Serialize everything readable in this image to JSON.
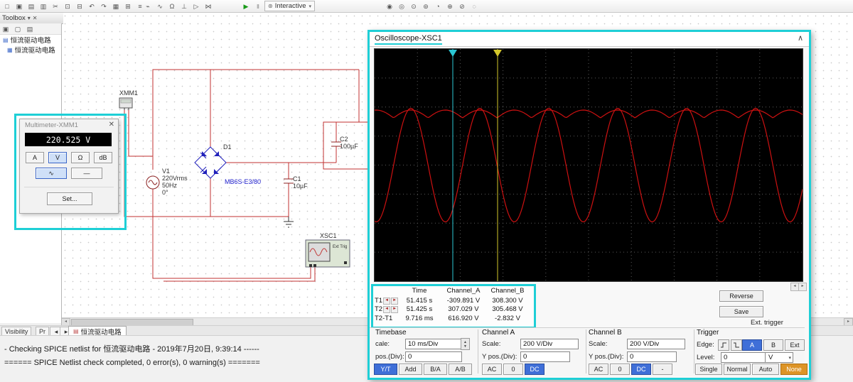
{
  "colors": {
    "highlight": "#1ecfd6",
    "wire": "#c03232",
    "trace": "#cc1111",
    "active_button": "#3f6fd8",
    "none_button": "#dd9426"
  },
  "top_toolbar": {
    "file_icons": [
      "□",
      "▣",
      "▤",
      "▥",
      "✂",
      "⊡",
      "⊟",
      "↶",
      "↷",
      "▦",
      "⊞",
      "≡"
    ],
    "component_icons": [
      "⌁",
      "∿",
      "Ω",
      "⊥",
      "▷",
      "⋈"
    ],
    "probe_icons": [
      "◉",
      "◎",
      "⊙",
      "⊚",
      "◔",
      "⊕",
      "⊘",
      "◌"
    ],
    "play_icon": "▶",
    "pause_icon": "Ⅱ",
    "stop_icon": "■",
    "gear_icon": "⊛",
    "caret_icon": "▾",
    "run_label": "Interactive"
  },
  "toolbox": {
    "title": "Toolbox",
    "pin_icon": "▾",
    "close_icon": "✕",
    "mini_icons": [
      "▣",
      "▢",
      "▤"
    ],
    "tree": [
      {
        "glyph": "▤",
        "label": "恒流驱动电路"
      },
      {
        "glyph": "▦",
        "label": "恒流驱动电路"
      }
    ]
  },
  "schematic": {
    "xmm1_label": "XMM1",
    "v1": {
      "ref": "V1",
      "value": "220Vrms",
      "freq": "50Hz",
      "phase": "0°"
    },
    "d1": {
      "ref": "D1",
      "part": "MB6S-E3/80"
    },
    "c1": {
      "ref": "C1",
      "value": "10µF"
    },
    "c2": {
      "ref": "C2",
      "value": "100µF"
    },
    "xsc1": {
      "ref": "XSC1",
      "ext_trig": "Ext Trig"
    }
  },
  "multimeter": {
    "title": "Multimeter-XMM1",
    "close_icon": "✕",
    "reading": "220.525 V",
    "mode_buttons": [
      {
        "label": "A"
      },
      {
        "label": "V",
        "active": true
      },
      {
        "label": "Ω"
      },
      {
        "label": "dB"
      }
    ],
    "wave_buttons": [
      {
        "label": "∿",
        "active": true
      },
      {
        "label": "—"
      }
    ],
    "set_label": "Set..."
  },
  "oscilloscope": {
    "title": "Oscilloscope-XSC1",
    "collapse_icon": "∧",
    "scroll_left_icon": "◂",
    "scroll_right_icon": "▸",
    "readout": {
      "headers": [
        "Time",
        "Channel_A",
        "Channel_B"
      ],
      "rows": [
        {
          "label": "T1",
          "arrowL": "◄",
          "arrowR": "►",
          "time": "51.415 s",
          "cha": "-309.891 V",
          "chb": "308.300 V"
        },
        {
          "label": "T2",
          "arrowL": "◄",
          "arrowR": "►",
          "time": "51.425 s",
          "cha": "307.029 V",
          "chb": "305.468 V"
        },
        {
          "label": "T2-T1",
          "arrowL": "",
          "arrowR": "",
          "time": "9.716 ms",
          "cha": "616.920 V",
          "chb": "-2.832 V"
        }
      ]
    },
    "reverse_label": "Reverse",
    "save_label": "Save",
    "ext_trigger_label": "Ext. trigger",
    "timebase": {
      "title": "Timebase",
      "scale_label": "cale:",
      "scale_value": "10 ms/Div",
      "pos_label": "pos.(Div):",
      "pos_value": "0",
      "buttons": [
        {
          "label": "Y/T",
          "active": true
        },
        {
          "label": "Add"
        },
        {
          "label": "B/A"
        },
        {
          "label": "A/B"
        }
      ]
    },
    "channel_a": {
      "title": "Channel A",
      "scale_label": "Scale:",
      "scale_value": "200  V/Div",
      "pos_label": "Y pos.(Div):",
      "pos_value": "0",
      "buttons": [
        {
          "label": "AC"
        },
        {
          "label": "0"
        },
        {
          "label": "DC",
          "active": true
        }
      ]
    },
    "channel_b": {
      "title": "Channel B",
      "scale_label": "Scale:",
      "scale_value": "200  V/Div",
      "pos_label": "Y pos.(Div):",
      "pos_value": "0",
      "buttons": [
        {
          "label": "AC"
        },
        {
          "label": "0"
        },
        {
          "label": "DC",
          "active": true
        },
        {
          "label": "-"
        }
      ]
    },
    "trigger": {
      "title": "Trigger",
      "edge_label": "Edge:",
      "edge_buttons": [
        {
          "label": "A",
          "active": true
        },
        {
          "label": "B"
        },
        {
          "label": "Ext"
        }
      ],
      "level_label": "Level:",
      "level_value": "0",
      "unit": "V",
      "mode_buttons": [
        {
          "label": "Single"
        },
        {
          "label": "Normal"
        },
        {
          "label": "Auto"
        },
        {
          "label": "None",
          "active": true,
          "orange": true
        }
      ]
    }
  },
  "chart_data": {
    "type": "line",
    "title": "Oscilloscope-XSC1 traces",
    "x_axis": {
      "label": "Time",
      "scale": "10 ms/Div",
      "divisions": 10
    },
    "y_axis": {
      "scale": "200 V/Div",
      "divisions": 8
    },
    "series": [
      {
        "name": "Channel_A",
        "shape": "sine",
        "amplitude_V": 310,
        "period_ms": 20,
        "color": "#cc1111"
      },
      {
        "name": "Channel_B",
        "shape": "filtered_dc_ripple",
        "mean_V": 306,
        "ripple_V": 20,
        "color": "#cc1111"
      }
    ],
    "cursors": [
      {
        "name": "T1",
        "time_s": 51.415,
        "channel_a_V": -309.891,
        "channel_b_V": 308.3,
        "color": "#2bc7d4"
      },
      {
        "name": "T2",
        "time_s": 51.425,
        "channel_a_V": 307.029,
        "channel_b_V": 305.468,
        "color": "#d4c72b"
      }
    ]
  },
  "tabs": {
    "visibility": "Visibility",
    "pr": "Pr",
    "left_arrow": "◂",
    "right_arrow": "▸",
    "sheet": "恒流驱动电路",
    "sheet_glyph": "▤"
  },
  "status": {
    "line1": "- Checking SPICE netlist for 恒流驱动电路 - 2019年7月20日, 9:39:14 ------",
    "line2": "====== SPICE Netlist check completed, 0 error(s), 0 warning(s) ======="
  }
}
